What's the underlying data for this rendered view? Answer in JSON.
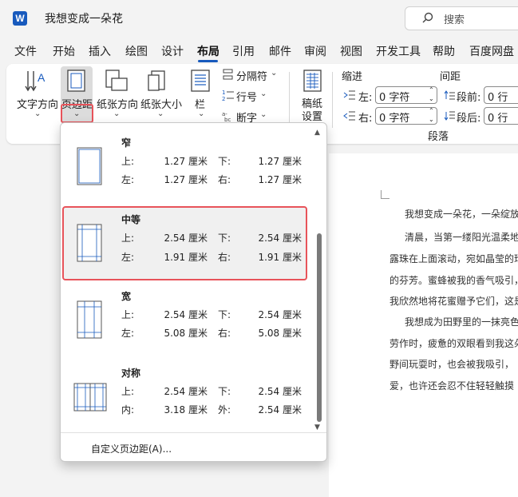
{
  "title_bar": {
    "app_icon_letter": "W",
    "doc_title": "我想变成一朵花",
    "search_placeholder": "搜索"
  },
  "tabs": [
    "文件",
    "开始",
    "插入",
    "绘图",
    "设计",
    "布局",
    "引用",
    "邮件",
    "审阅",
    "视图",
    "开发工具",
    "帮助",
    "百度网盘"
  ],
  "active_tab": "布局",
  "ribbon": {
    "text_direction": "文字方向",
    "margins": "页边距",
    "orientation": "纸张方向",
    "size": "纸张大小",
    "columns": "栏",
    "breaks": "分隔符",
    "line_numbers": "行号",
    "hyphenation": "断字",
    "manuscript": [
      "稿纸",
      "设置"
    ],
    "indent_title": "缩进",
    "spacing_title": "间距",
    "indent_left_label": "左:",
    "indent_left_value": "0 字符",
    "indent_right_label": "右:",
    "indent_right_value": "0 字符",
    "spacing_before_label": "段前:",
    "spacing_before_value": "0 行",
    "spacing_after_label": "段后:",
    "spacing_after_value": "0 行",
    "paragraph_group": "段落"
  },
  "margins_menu": {
    "options": [
      {
        "name": "窄",
        "k1": "上:",
        "v1": "1.27 厘米",
        "k2": "下:",
        "v2": "1.27 厘米",
        "k3": "左:",
        "v3": "1.27 厘米",
        "k4": "右:",
        "v4": "1.27 厘米"
      },
      {
        "name": "中等",
        "k1": "上:",
        "v1": "2.54 厘米",
        "k2": "下:",
        "v2": "2.54 厘米",
        "k3": "左:",
        "v3": "1.91 厘米",
        "k4": "右:",
        "v4": "1.91 厘米"
      },
      {
        "name": "宽",
        "k1": "上:",
        "v1": "2.54 厘米",
        "k2": "下:",
        "v2": "2.54 厘米",
        "k3": "左:",
        "v3": "5.08 厘米",
        "k4": "右:",
        "v4": "5.08 厘米"
      },
      {
        "name": "对称",
        "k1": "上:",
        "v1": "2.54 厘米",
        "k2": "下:",
        "v2": "2.54 厘米",
        "k3": "内:",
        "v3": "3.18 厘米",
        "k4": "外:",
        "v4": "2.54 厘米"
      }
    ],
    "selected": "中等",
    "custom": "自定义页边距(A)..."
  },
  "document": {
    "lines": [
      "我想变成一朵花，一朵绽放",
      "清晨，当第一缕阳光温柔地",
      "露珠在上面滚动，宛如晶莹的珍",
      "的芬芳。蜜蜂被我的香气吸引，",
      "我欣然地将花蜜赠予它们，这是",
      "我想成为田野里的一抹亮色",
      "劳作时，疲惫的双眼看到我这朵",
      "野间玩耍时，也会被我吸引，",
      "爱，也许还会忍不住轻轻触摸"
    ]
  },
  "colors": {
    "accent": "#185abd",
    "highlight_border": "#e8535a"
  }
}
